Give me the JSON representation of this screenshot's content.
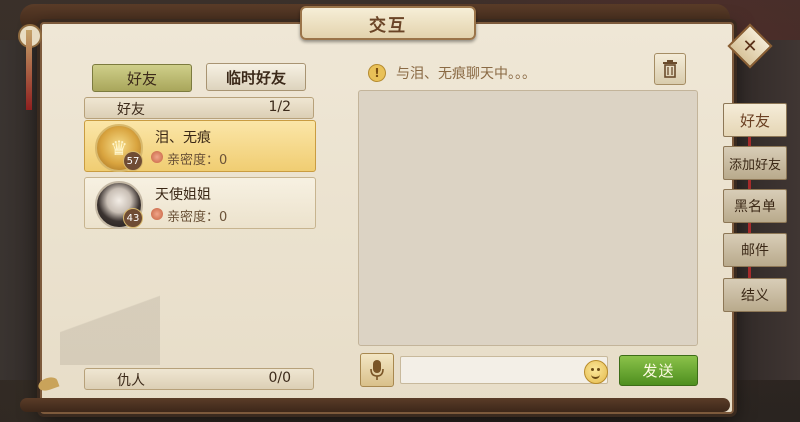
{
  "title": "交互",
  "tabs": {
    "friends": "好友",
    "temp_friends": "临时好友"
  },
  "friends_section": {
    "label": "好友",
    "count": "1/2"
  },
  "friends": [
    {
      "name": "泪、无痕",
      "level": "57",
      "intimacy": "亲密度：0",
      "selected": true,
      "avatar": "gold-emblem-avatar"
    },
    {
      "name": "天使姐姐",
      "level": "43",
      "intimacy": "亲密度：0",
      "selected": false,
      "avatar": "portrait-avatar"
    }
  ],
  "enemies_section": {
    "label": "仇人",
    "count": "0/0"
  },
  "chat": {
    "notice": "与泪、无痕聊天中。。。",
    "input_placeholder": "",
    "send_label": "发送"
  },
  "side_nav": [
    {
      "label": "好友",
      "active": true
    },
    {
      "label": "添加好友",
      "active": false
    },
    {
      "label": "黑名单",
      "active": false
    },
    {
      "label": "邮件",
      "active": false
    },
    {
      "label": "结义",
      "active": false
    }
  ],
  "colors": {
    "panel_bg": "#efe7d6",
    "selected_card": "#f0cd72",
    "send_button": "#6aa934",
    "accent_red": "#a62b2b"
  }
}
